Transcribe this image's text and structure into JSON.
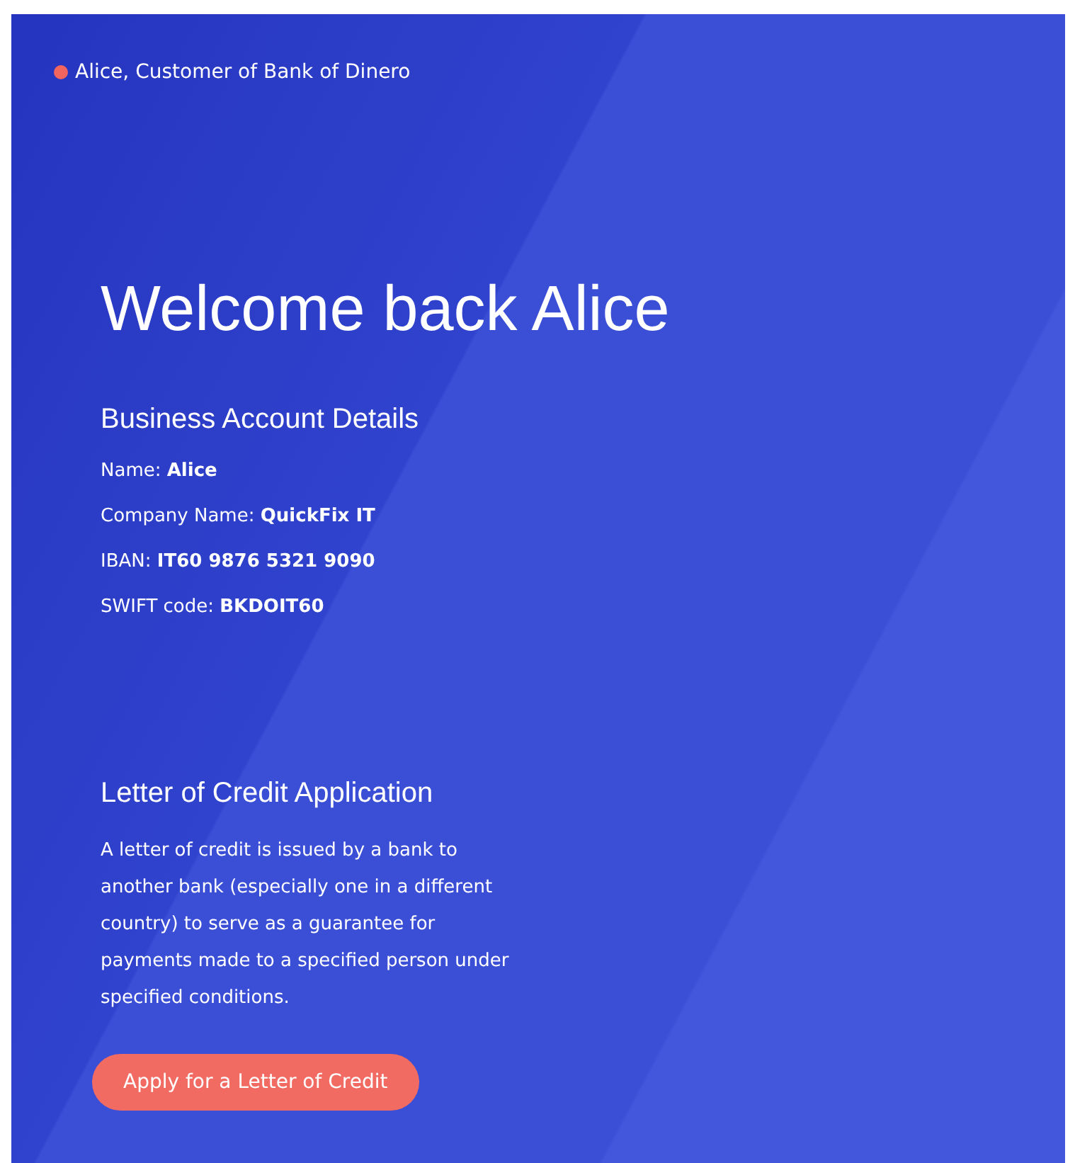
{
  "header": {
    "user_label": "Alice, Customer of Bank of Dinero"
  },
  "title": "Welcome back Alice",
  "account": {
    "heading": "Business Account Details",
    "details": [
      {
        "label": "Name:",
        "value": "Alice"
      },
      {
        "label": "Company Name:",
        "value": "QuickFix IT"
      },
      {
        "label": "IBAN:",
        "value": "IT60 9876 5321 9090"
      },
      {
        "label": "SWIFT code:",
        "value": "BKDOIT60"
      }
    ]
  },
  "letter_of_credit": {
    "heading": "Letter of Credit Application",
    "description": "A letter of credit is issued by a bank to another bank (especially one in a different country) to serve as a guarantee for payments made to a specified person under specified conditions.",
    "button": "Apply for a Letter of Credit"
  }
}
